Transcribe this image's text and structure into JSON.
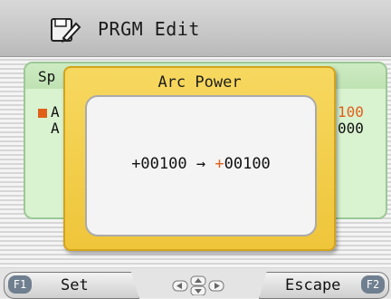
{
  "titlebar": {
    "icon": "edit-program-icon",
    "title": "PRGM Edit"
  },
  "panel": {
    "header_label": "Sp",
    "rows": [
      {
        "label": "A",
        "value": "100",
        "value_color": "#e0601a"
      },
      {
        "label": "A",
        "value": "000",
        "value_color": "#111111"
      }
    ]
  },
  "dialog": {
    "title": "Arc Power",
    "old_value": "+00100",
    "arrow": "→",
    "new_sign": "+",
    "new_value": "00100"
  },
  "softkeys": {
    "f1": {
      "key": "F1",
      "label": "Set"
    },
    "f2": {
      "key": "F2",
      "label": "Escape"
    }
  },
  "colors": {
    "accent_orange": "#e0601a",
    "dialog_yellow": "#f2cc45",
    "panel_green": "#d9f2d0"
  }
}
